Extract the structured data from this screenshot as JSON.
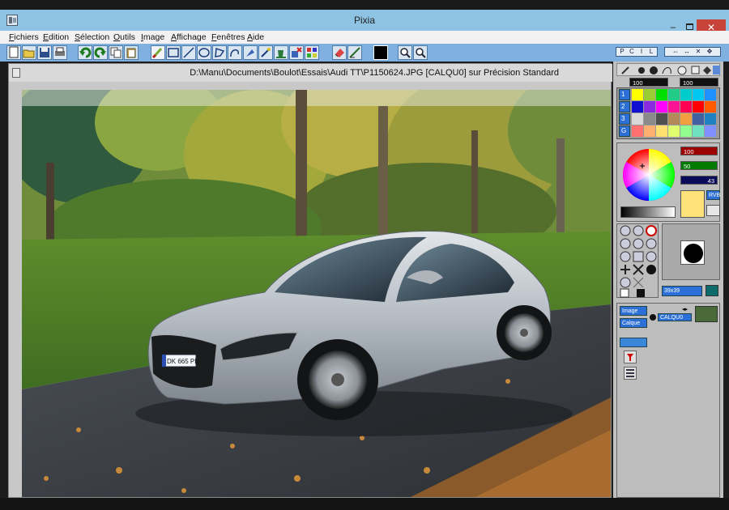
{
  "window": {
    "title": "Pixia",
    "minimize_label": "–",
    "close_label": "✕"
  },
  "menu": [
    "Fichiers",
    "Edition",
    "Sélection",
    "Outils",
    "Image",
    "Affichage",
    "Fenêtres",
    "Aide"
  ],
  "document": {
    "title": "D:\\Manu\\Documents\\Boulot\\Essais\\Audi TT\\P1150624.JPG [CALQU0] sur Précision Standard",
    "plate_text": "DK 665 PL"
  },
  "toolbar": {
    "icons": [
      "new-file-icon",
      "open-icon",
      "save-icon",
      "print-icon",
      "undo-icon",
      "redo-icon",
      "copy-icon",
      "paste-icon",
      "brush-icon",
      "rectangle-icon",
      "line-icon",
      "ellipse-icon",
      "lasso-icon",
      "curve-lasso-icon",
      "fill-icon",
      "magic-wand-icon",
      "bucket-icon",
      "transform-icon",
      "grid-icon",
      "eraser-icon",
      "smudge-icon",
      "zoom-in-icon",
      "zoom-out-icon"
    ],
    "black_color": "#000000"
  },
  "panel": {
    "tabs": [
      "P",
      "C",
      "I",
      "L"
    ],
    "size_a": "100",
    "size_b": "100",
    "palette_rows": [
      "1",
      "2",
      "3",
      "G"
    ],
    "rgb_values": [
      "100",
      "50",
      "43"
    ],
    "rgb_label": "RVB",
    "brush_size": "39x39",
    "layers_tabs": [
      "Image",
      "Calque"
    ],
    "layer_name": "CALQU0",
    "accent": "#2c6fd6"
  }
}
